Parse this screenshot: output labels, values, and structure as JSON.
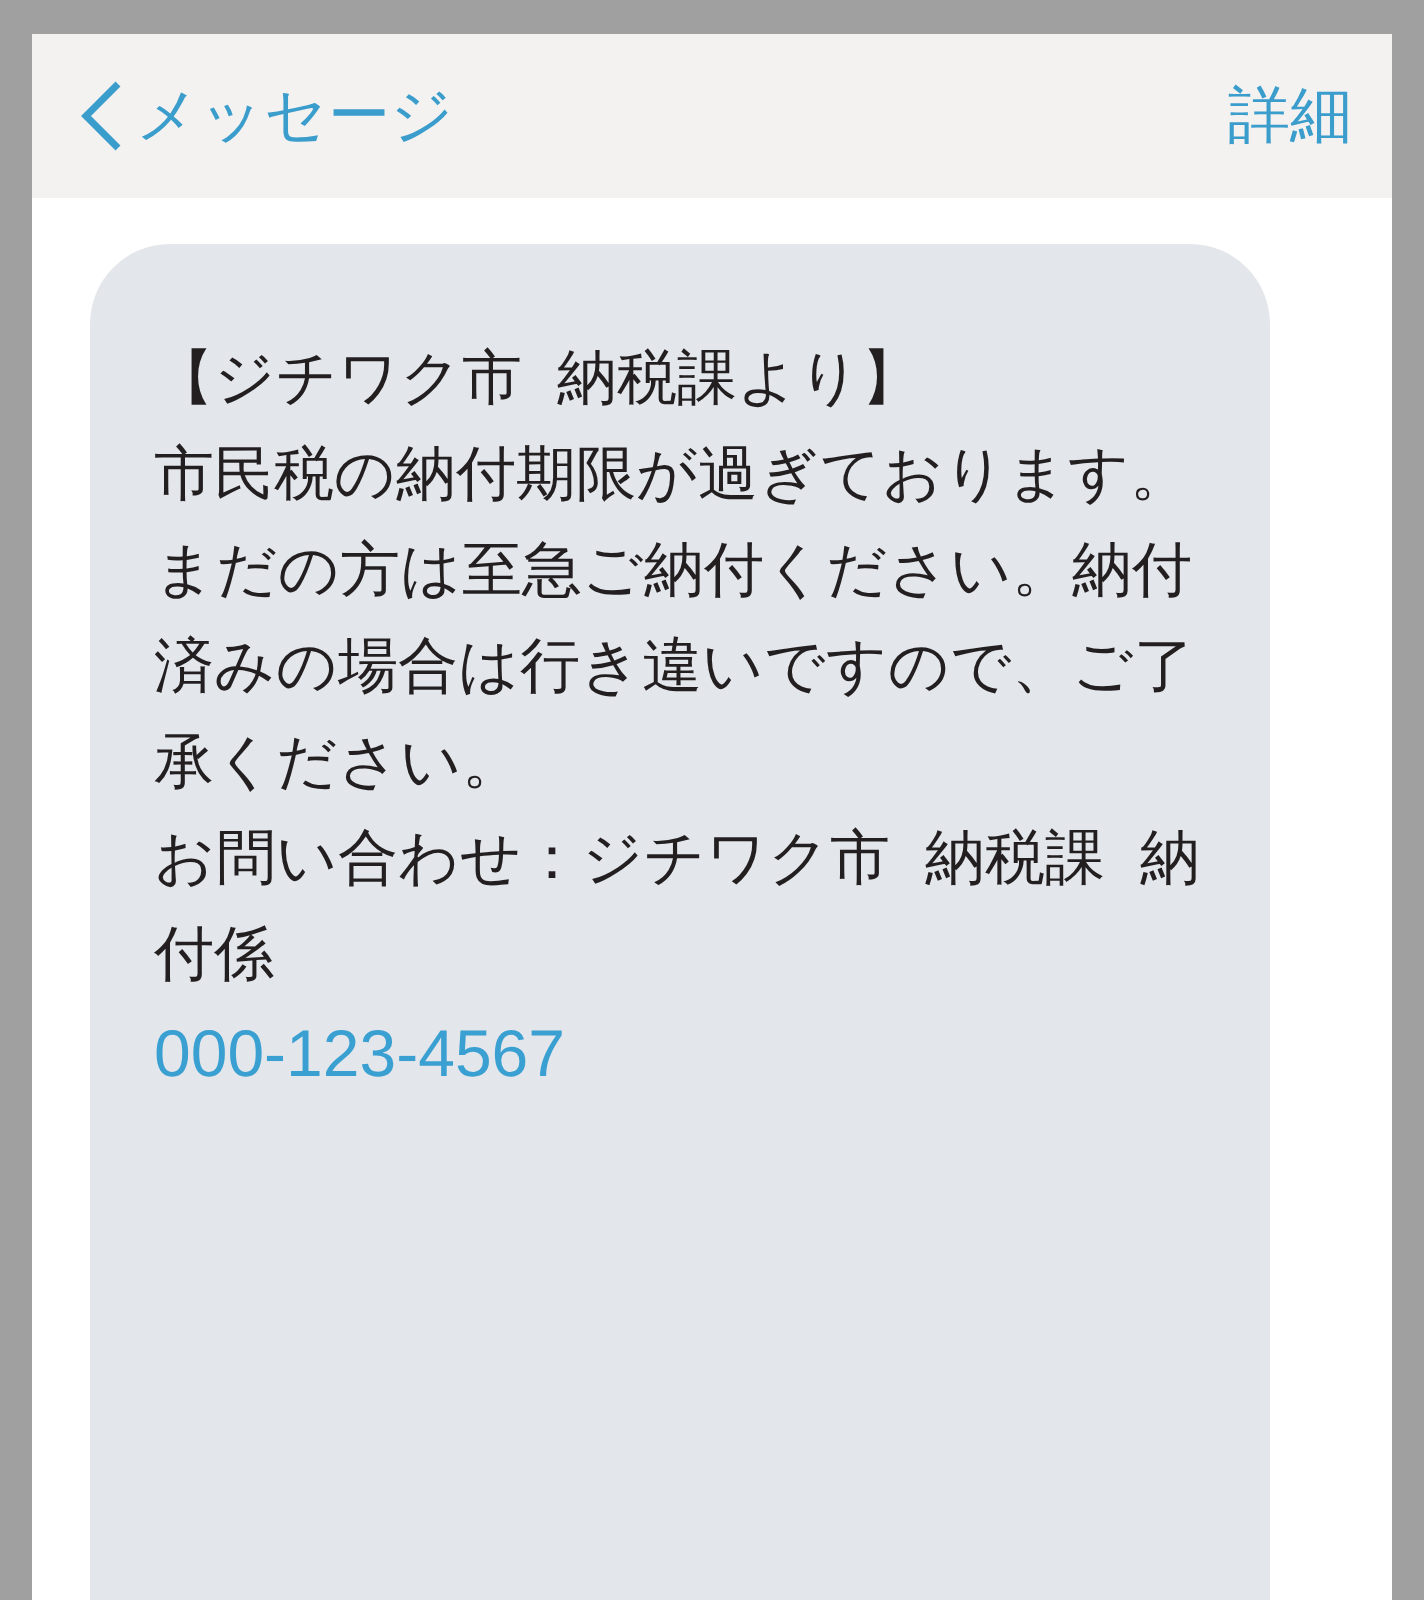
{
  "nav_bar": {
    "back_label": "メッセージ",
    "action_label": "詳細"
  },
  "message": {
    "paragraphs": [
      "【ジチワク市 納税課より】",
      "市民税の納付期限が過ぎております。まだの方は至急ご納付ください。納付済みの場合は行き違いですので、ご了承ください。",
      "お問い合わせ：ジチワク市 納税課 納付係"
    ],
    "phone_link": "000-123-4567"
  }
}
